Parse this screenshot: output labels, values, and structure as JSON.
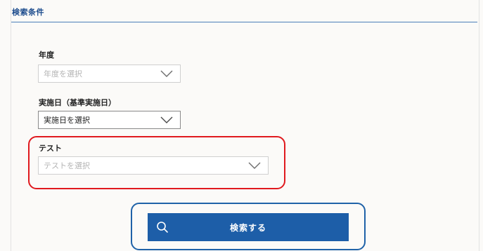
{
  "section": {
    "title": "検索条件"
  },
  "fields": {
    "year": {
      "label": "年度",
      "placeholder": "年度を選択"
    },
    "date": {
      "label": "実施日（基準実施日）",
      "value": "実施日を選択"
    },
    "test": {
      "label": "テスト",
      "placeholder": "テストを選択"
    }
  },
  "search_button": {
    "label": "検索する",
    "icon": "search-icon"
  },
  "colors": {
    "accent": "#1d5ea8",
    "highlight_red": "#e0191e",
    "highlight_blue": "#1f62a8"
  }
}
